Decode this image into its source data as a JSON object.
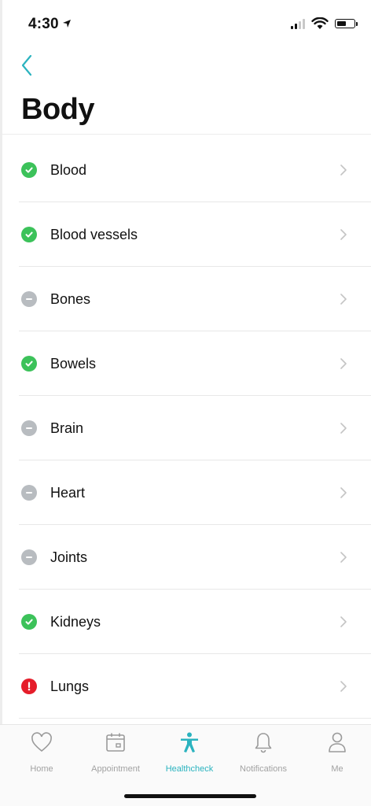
{
  "status_bar": {
    "time": "4:30"
  },
  "header": {
    "title": "Body"
  },
  "colors": {
    "ok": "#3cc25a",
    "neutral": "#b8bcc0",
    "alert": "#e51d2a",
    "accent": "#2bb3bf"
  },
  "items": [
    {
      "label": "Blood",
      "status": "ok"
    },
    {
      "label": "Blood vessels",
      "status": "ok"
    },
    {
      "label": "Bones",
      "status": "neutral"
    },
    {
      "label": "Bowels",
      "status": "ok"
    },
    {
      "label": "Brain",
      "status": "neutral"
    },
    {
      "label": "Heart",
      "status": "neutral"
    },
    {
      "label": "Joints",
      "status": "neutral"
    },
    {
      "label": "Kidneys",
      "status": "ok"
    },
    {
      "label": "Lungs",
      "status": "alert"
    }
  ],
  "tabs": [
    {
      "label": "Home",
      "icon": "heart-icon"
    },
    {
      "label": "Appointment",
      "icon": "calendar-icon"
    },
    {
      "label": "Healthcheck",
      "icon": "person-icon",
      "active": true
    },
    {
      "label": "Notifications",
      "icon": "bell-icon"
    },
    {
      "label": "Me",
      "icon": "user-icon"
    }
  ]
}
